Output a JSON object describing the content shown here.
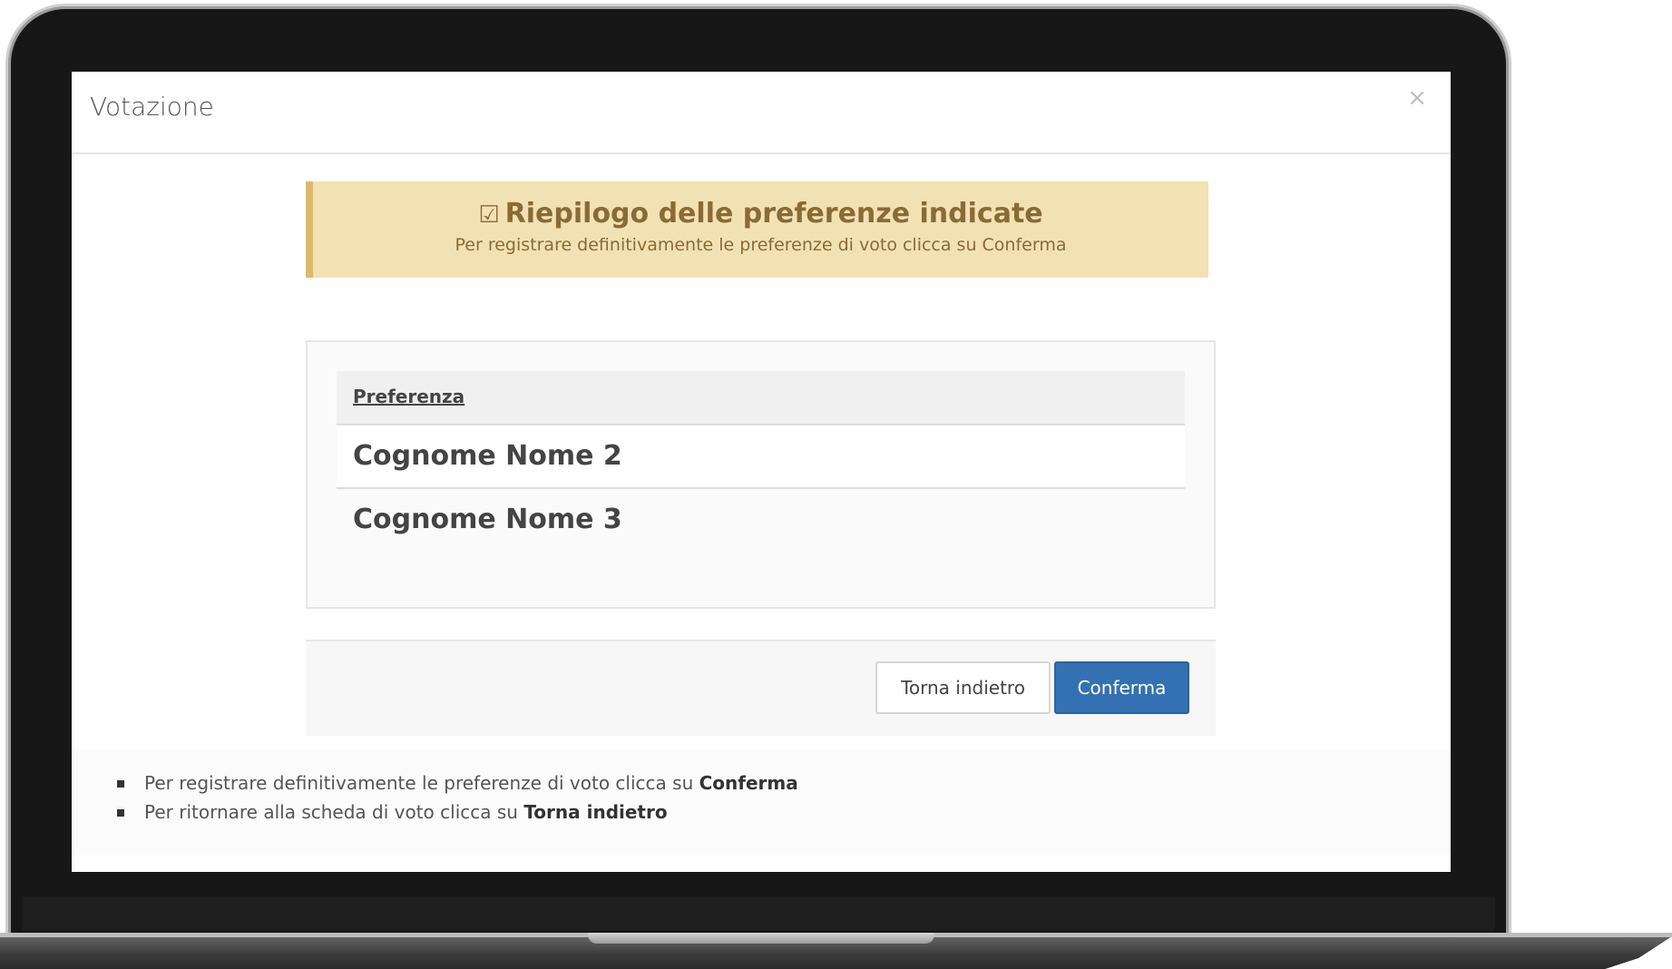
{
  "modal": {
    "title": "Votazione",
    "close_label": "×"
  },
  "alert": {
    "icon": "check-square-icon",
    "title": "Riepilogo delle preferenze indicate",
    "subtitle": "Per registrare definitivamente le preferenze di voto clicca su Conferma"
  },
  "table": {
    "header": "Preferenza",
    "rows": [
      "Cognome Nome 2",
      "Cognome Nome 3"
    ]
  },
  "buttons": {
    "back_label": "Torna indietro",
    "confirm_label": "Conferma"
  },
  "help": {
    "items": [
      {
        "text": "Per registrare definitivamente le preferenze di voto clicca su ",
        "bold": "Conferma"
      },
      {
        "text": "Per ritornare alla scheda di voto clicca su ",
        "bold": "Torna indietro"
      }
    ]
  },
  "colors": {
    "alert_bg": "#f2e2b3",
    "alert_border": "#ddb86c",
    "alert_text": "#8a6a35",
    "primary": "#3471b3"
  }
}
